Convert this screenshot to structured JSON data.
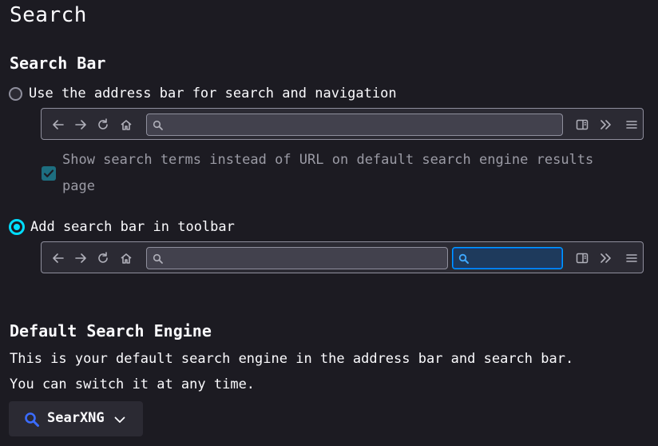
{
  "page": {
    "title": "Search"
  },
  "search_bar": {
    "title": "Search Bar",
    "option_address_bar": {
      "label": "Use the address bar for search and navigation",
      "selected": false
    },
    "show_terms": {
      "label_line1": "Show search terms instead of URL on default search engine results",
      "label_line2": "page",
      "checked": true,
      "disabled": true
    },
    "option_toolbar": {
      "label": "Add search bar in toolbar",
      "selected": true
    }
  },
  "default_engine": {
    "title": "Default Search Engine",
    "desc_line1": "This is your default search engine in the address bar and search bar.",
    "desc_line2": "You can switch it at any time.",
    "selected_engine": "SearXNG"
  },
  "colors": {
    "accent": "#00ddff",
    "focus": "#00a2ff",
    "background": "#1c1b22",
    "surface": "#2b2a33",
    "checkbox": "#1d6e80"
  },
  "icons": [
    "back-icon",
    "forward-icon",
    "reload-icon",
    "home-icon",
    "search-icon",
    "sidebar-icon",
    "overflow-icon",
    "menu-icon",
    "chevron-down-icon"
  ]
}
